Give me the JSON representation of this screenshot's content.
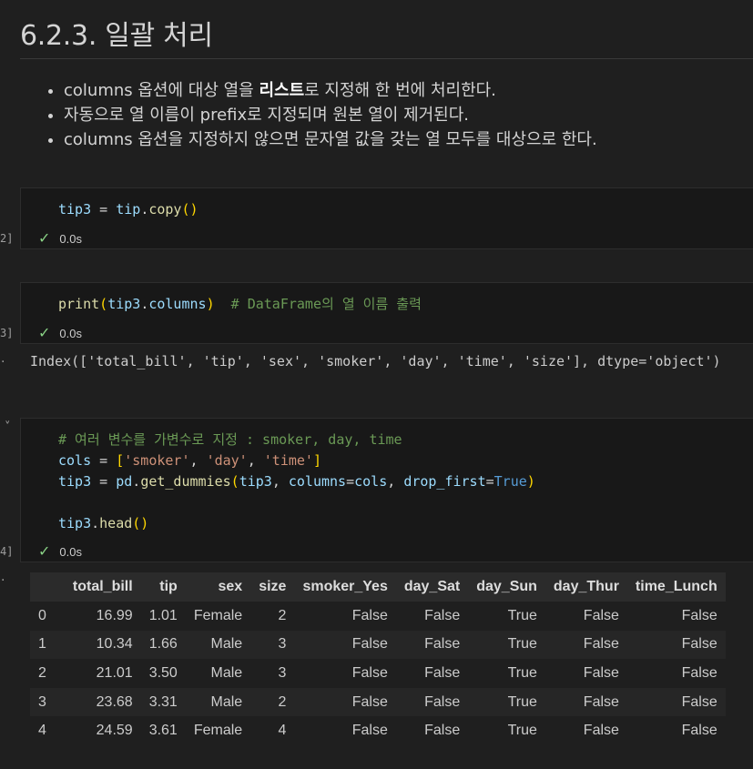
{
  "markdown": {
    "heading": "6.2.3. 일괄 처리",
    "bullets": [
      {
        "pre": "columns 옵션에 대상 열을 ",
        "bold": "리스트",
        "post": "로 지정해 한 번에 처리한다."
      },
      {
        "pre": "자동으로 열 이름이 prefix로 지정되며 원본 열이 제거된다.",
        "bold": "",
        "post": ""
      },
      {
        "pre": "columns 옵션을 지정하지 않으면 문자열 값을 갖는 열 모두를 대상으로 한다.",
        "bold": "",
        "post": ""
      }
    ]
  },
  "cells": [
    {
      "exec_label": "2]",
      "status": "0.0s"
    },
    {
      "exec_label": "3]",
      "status": "0.0s"
    },
    {
      "exec_label": "4]",
      "status": "0.0s"
    }
  ],
  "code": {
    "c1": {
      "var": "tip3",
      "eq": " = ",
      "obj": "tip",
      "dot": ".",
      "fn": "copy",
      "paren": "()"
    },
    "c2": {
      "fn": "print",
      "open": "(",
      "arg": "tip3",
      "dot": ".",
      "attr": "columns",
      "close": ")",
      "comment": "  # DataFrame의 열 이름 출력"
    },
    "c3": {
      "comment": "# 여러 변수를 가변수로 지정 : smoker, day, time",
      "l2_var": "cols",
      "l2_eq": " = ",
      "l2_open": "[",
      "s1": "'smoker'",
      "comma1": ", ",
      "s2": "'day'",
      "comma2": ", ",
      "s3": "'time'",
      "l2_close": "]",
      "l3_var": "tip3",
      "l3_eq": " = ",
      "l3_mod": "pd",
      "l3_dot": ".",
      "l3_fn": "get_dummies",
      "l3_open": "(",
      "l3_a1": "tip3",
      "l3_c1": ", ",
      "l3_k1": "columns",
      "l3_eq1": "=",
      "l3_v1": "cols",
      "l3_c2": ", ",
      "l3_k2": "drop_first",
      "l3_eq2": "=",
      "l3_v2": "True",
      "l3_close": ")",
      "l5_var": "tip3",
      "l5_dot": ".",
      "l5_fn": "head",
      "l5_paren": "()"
    }
  },
  "output_text": "Index(['total_bill', 'tip', 'sex', 'smoker', 'day', 'time', 'size'], dtype='object')",
  "table": {
    "columns": [
      "",
      "total_bill",
      "tip",
      "sex",
      "size",
      "smoker_Yes",
      "day_Sat",
      "day_Sun",
      "day_Thur",
      "time_Lunch"
    ],
    "rows": [
      [
        "0",
        "16.99",
        "1.01",
        "Female",
        "2",
        "False",
        "False",
        "True",
        "False",
        "False"
      ],
      [
        "1",
        "10.34",
        "1.66",
        "Male",
        "3",
        "False",
        "False",
        "True",
        "False",
        "False"
      ],
      [
        "2",
        "21.01",
        "3.50",
        "Male",
        "3",
        "False",
        "False",
        "True",
        "False",
        "False"
      ],
      [
        "3",
        "23.68",
        "3.31",
        "Male",
        "2",
        "False",
        "False",
        "True",
        "False",
        "False"
      ],
      [
        "4",
        "24.59",
        "3.61",
        "Female",
        "4",
        "False",
        "False",
        "True",
        "False",
        "False"
      ]
    ]
  },
  "glyphs": {
    "check": "✓",
    "bullet_dot": "·",
    "chevron": "˅"
  }
}
